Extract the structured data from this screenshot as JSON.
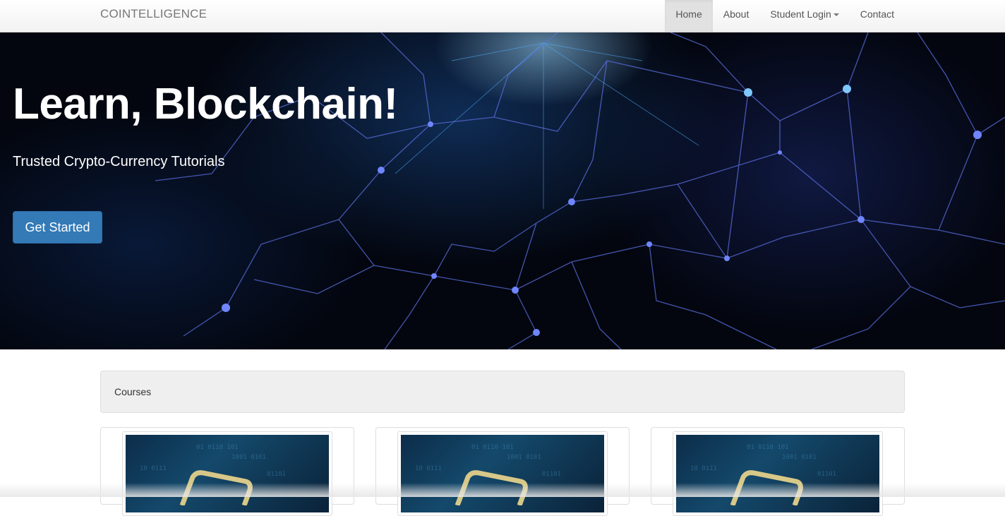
{
  "navbar": {
    "brand": "COINTELLIGENCE",
    "items": [
      {
        "label": "Home",
        "active": true
      },
      {
        "label": "About"
      },
      {
        "label": "Student Login",
        "dropdown": true
      },
      {
        "label": "Contact"
      }
    ]
  },
  "hero": {
    "title": "Learn, Blockchain!",
    "subtitle": "Trusted Crypto-Currency Tutorials",
    "cta_label": "Get Started"
  },
  "courses": {
    "heading": "Courses"
  },
  "colors": {
    "primary": "#337ab7",
    "hero_bg": "#03060f",
    "network_line": "#5b6fe0"
  }
}
